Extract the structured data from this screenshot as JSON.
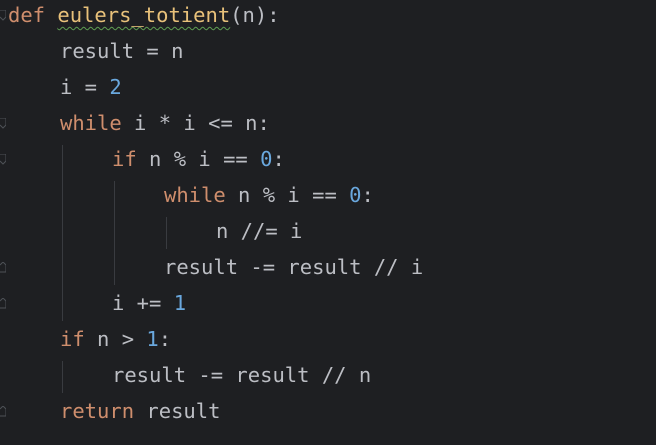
{
  "colors": {
    "background": "#1e1f22",
    "keyword": "#cf8e6d",
    "function_name": "#e8c17a",
    "number": "#6aa8de",
    "identifier": "#bcbec4",
    "indent_guide": "#393b40",
    "warning_underline": "#5f9e52"
  },
  "code_lines": [
    {
      "indent": 0,
      "tokens": [
        {
          "t": "def",
          "k": "kw"
        },
        {
          "t": " ",
          "k": "plain"
        },
        {
          "t": "eulers_totient",
          "k": "fn"
        },
        {
          "t": "(n):",
          "k": "plain"
        }
      ]
    },
    {
      "indent": 1,
      "tokens": [
        {
          "t": "result = n",
          "k": "plain"
        }
      ]
    },
    {
      "indent": 1,
      "tokens": [
        {
          "t": "i = ",
          "k": "plain"
        },
        {
          "t": "2",
          "k": "num"
        }
      ]
    },
    {
      "indent": 1,
      "tokens": [
        {
          "t": "while",
          "k": "kw"
        },
        {
          "t": " i * i <= n:",
          "k": "plain"
        }
      ]
    },
    {
      "indent": 2,
      "tokens": [
        {
          "t": "if",
          "k": "kw"
        },
        {
          "t": " n % i == ",
          "k": "plain"
        },
        {
          "t": "0",
          "k": "num"
        },
        {
          "t": ":",
          "k": "plain"
        }
      ]
    },
    {
      "indent": 3,
      "tokens": [
        {
          "t": "while",
          "k": "kw"
        },
        {
          "t": " n % i == ",
          "k": "plain"
        },
        {
          "t": "0",
          "k": "num"
        },
        {
          "t": ":",
          "k": "plain"
        }
      ]
    },
    {
      "indent": 4,
      "tokens": [
        {
          "t": "n //= i",
          "k": "plain"
        }
      ]
    },
    {
      "indent": 3,
      "tokens": [
        {
          "t": "result -= result // i",
          "k": "plain"
        }
      ]
    },
    {
      "indent": 2,
      "tokens": [
        {
          "t": "i += ",
          "k": "plain"
        },
        {
          "t": "1",
          "k": "num"
        }
      ]
    },
    {
      "indent": 1,
      "tokens": [
        {
          "t": "if",
          "k": "kw"
        },
        {
          "t": " n > ",
          "k": "plain"
        },
        {
          "t": "1",
          "k": "num"
        },
        {
          "t": ":",
          "k": "plain"
        }
      ]
    },
    {
      "indent": 2,
      "tokens": [
        {
          "t": "result -= result // n",
          "k": "plain"
        }
      ]
    },
    {
      "indent": 1,
      "tokens": [
        {
          "t": "return",
          "k": "kw"
        },
        {
          "t": " result",
          "k": "plain"
        }
      ]
    }
  ]
}
